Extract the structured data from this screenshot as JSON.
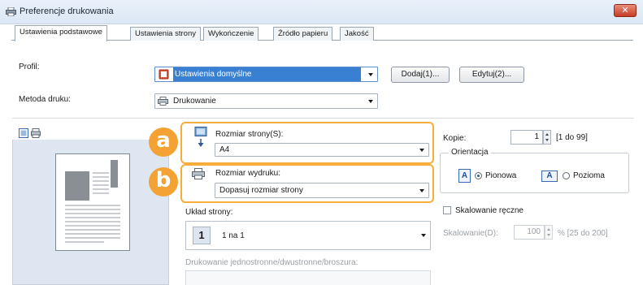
{
  "window": {
    "title": "Preferencje drukowania",
    "close_label": "✕"
  },
  "tabs": [
    {
      "label": "Ustawienia podstawowe"
    },
    {
      "label": "Ustawienia strony"
    },
    {
      "label": "Wykończenie"
    },
    {
      "label": "Źródło papieru"
    },
    {
      "label": "Jakość"
    }
  ],
  "profile": {
    "label": "Profil:",
    "value": "Ustawienia domyślne",
    "add_label": "Dodaj(1)...",
    "edit_label": "Edytuj(2)..."
  },
  "print_method": {
    "label": "Metoda druku:",
    "value": "Drukowanie"
  },
  "page_size": {
    "label": "Rozmiar strony(S):",
    "value": "A4"
  },
  "output_size": {
    "label": "Rozmiar wydruku:",
    "value": "Dopasuj rozmiar strony"
  },
  "page_layout": {
    "label": "Układ strony:",
    "value": "1 na 1",
    "number": "1"
  },
  "duplex": {
    "label": "Drukowanie jednostronne/dwustronne/broszura:"
  },
  "copies": {
    "label": "Kopie:",
    "value": "1",
    "range": "[1 do 99]"
  },
  "orientation": {
    "legend": "Orientacja",
    "portrait_label": "Pionowa",
    "landscape_label": "Pozioma",
    "letter": "A"
  },
  "manual_scaling": {
    "label": "Skalowanie ręczne"
  },
  "scaling": {
    "label": "Skalowanie(D):",
    "value": "100",
    "unit_range": "% [25 do 200]"
  },
  "callouts": {
    "a": "a",
    "b": "b"
  },
  "colors": {
    "accent": "#f4a233",
    "selection": "#3a80d2"
  }
}
